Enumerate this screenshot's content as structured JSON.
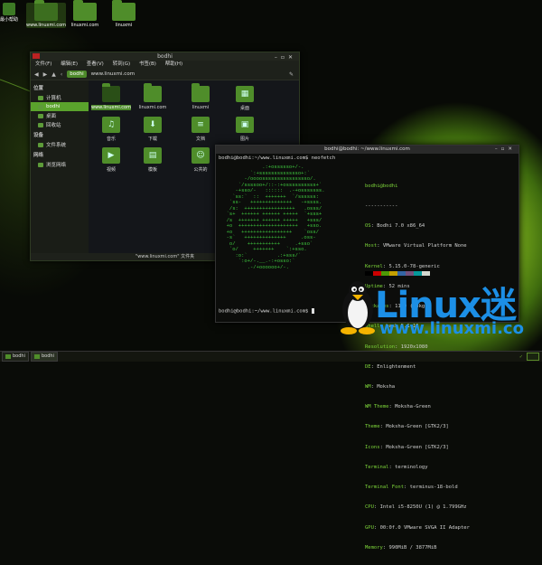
{
  "desktop": {
    "home_label": "最小帮助",
    "icons": [
      {
        "label": "www.linuxmi.com",
        "selected": true
      },
      {
        "label": "linuxmi.com"
      },
      {
        "label": "linuxmi"
      }
    ]
  },
  "file_manager": {
    "title": "bodhi",
    "menu": [
      "文件(F)",
      "编辑(E)",
      "查看(V)",
      "转到(G)",
      "书签(B)",
      "帮助(H)"
    ],
    "breadcrumb": "bodhi",
    "path": "www.linuxmi.com",
    "sidebar": {
      "section_places": "位置",
      "section_devices": "设备",
      "section_network": "网络",
      "places": [
        "计算机",
        "bodhi",
        "桌面",
        "回收站"
      ],
      "devices": [
        "文件系统"
      ],
      "network": [
        "浏览网络"
      ],
      "selected": "bodhi"
    },
    "items": [
      {
        "label": "www.linuxmi.com",
        "icon": "folder-icon",
        "selected": true
      },
      {
        "label": "linuxmi.com",
        "icon": "folder-icon"
      },
      {
        "label": "linuxmi",
        "icon": "folder-icon"
      },
      {
        "label": "桌面",
        "icon": "desktop-folder-icon"
      },
      {
        "label": "音乐",
        "icon": "music-folder-icon"
      },
      {
        "label": "下载",
        "icon": "download-folder-icon"
      },
      {
        "label": "文档",
        "icon": "documents-folder-icon"
      },
      {
        "label": "图片",
        "icon": "pictures-folder-icon"
      },
      {
        "label": "视频",
        "icon": "videos-folder-icon"
      },
      {
        "label": "模板",
        "icon": "templates-folder-icon"
      },
      {
        "label": "公共的",
        "icon": "public-folder-icon"
      }
    ],
    "status": "\"www.linuxmi.com\" 文件夹"
  },
  "terminal": {
    "title": "bodhi@bodhi: ~/www.linuxmi.com",
    "prompt_cmd": "bodhi@bodhi:~/www.linuxmi.com$ neofetch",
    "header": "bodhi@bodhi",
    "separator": "-----------",
    "info": [
      {
        "k": "OS",
        "v": "Bodhi 7.0 x86_64"
      },
      {
        "k": "Host",
        "v": "VMware Virtual Platform None"
      },
      {
        "k": "Kernel",
        "v": "5.15.0-78-generic"
      },
      {
        "k": "Uptime",
        "v": "52 mins"
      },
      {
        "k": "Packages",
        "v": "1169 (dpkg)"
      },
      {
        "k": "Shell",
        "v": "bash 5.1.16"
      },
      {
        "k": "Resolution",
        "v": "1920x1080"
      },
      {
        "k": "DE",
        "v": "Enlightenment"
      },
      {
        "k": "WM",
        "v": "Moksha"
      },
      {
        "k": "WM Theme",
        "v": "Moksha-Green"
      },
      {
        "k": "Theme",
        "v": "Moksha-Green [GTK2/3]"
      },
      {
        "k": "Icons",
        "v": "Moksha-Green [GTK2/3]"
      },
      {
        "k": "Terminal",
        "v": "terminology"
      },
      {
        "k": "Terminal Font",
        "v": "terminus-18-bold"
      },
      {
        "k": "CPU",
        "v": "Intel i5-8250U (1) @ 1.799GHz"
      },
      {
        "k": "GPU",
        "v": "00:0f.0 VMware SVGA II Adapter"
      },
      {
        "k": "Memory",
        "v": "990MiB / 3877MiB"
      }
    ],
    "prompt_end": "bodhi@bodhi:~/www.linuxmi.com$ ",
    "swatches": [
      "#000000",
      "#cc0000",
      "#4e9a06",
      "#c4a000",
      "#3465a4",
      "#75507b",
      "#06989a",
      "#d3d7cf"
    ]
  },
  "watermark": {
    "brand": "Linux",
    "brand_tail": "迷",
    "url": "www.linuxmi.co"
  },
  "taskbar": {
    "items": [
      "bodhi",
      "bodhi"
    ],
    "colors": {
      "accent": "#4f8d2a"
    }
  }
}
